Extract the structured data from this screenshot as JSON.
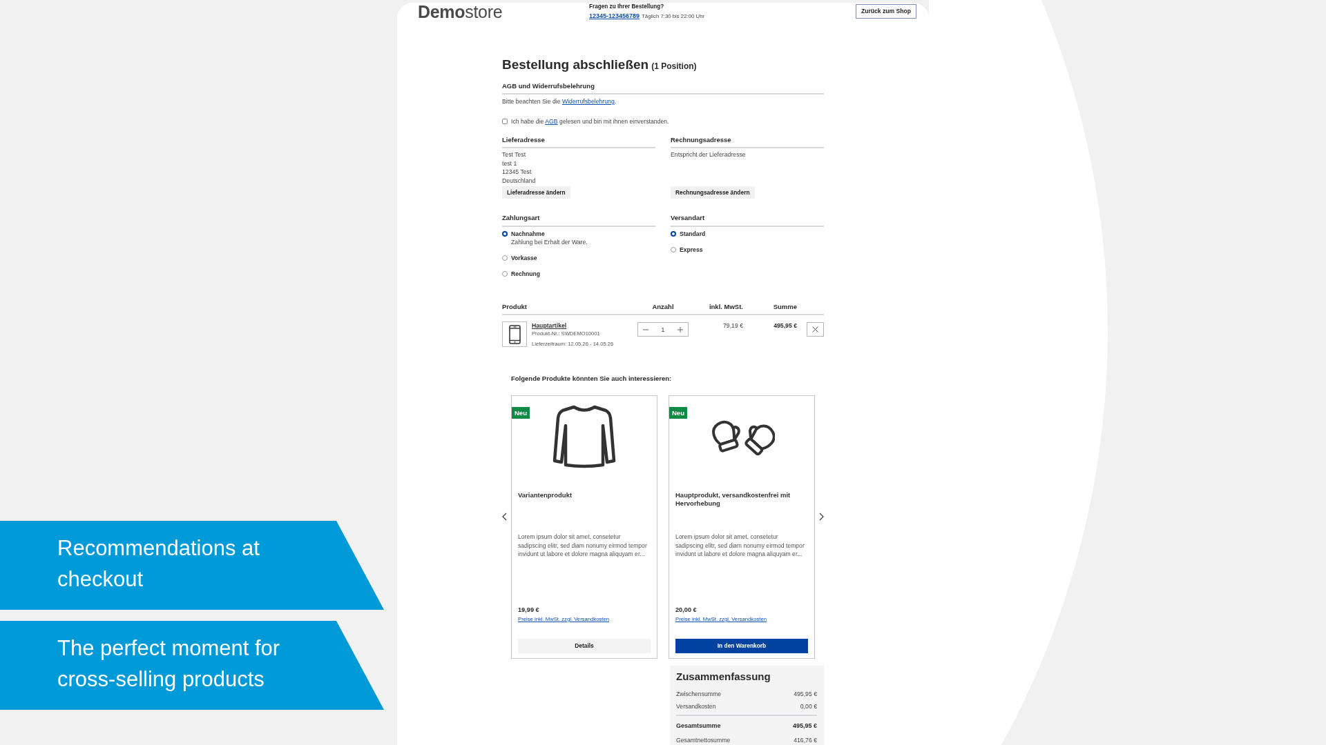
{
  "callouts": [
    "Recommendations at checkout",
    "The perfect moment for cross-selling products"
  ],
  "header": {
    "logo": "**Demo**store",
    "help_title": "Fragen zu Ihrer Bestellung?",
    "phone": "12345-123456789",
    "hours": "Täglich 7:30 bis 22:00 Uhr",
    "back_button": "Zurück zum Shop"
  },
  "title": "Bestellung abschließen",
  "title_count": "(1 Position)",
  "terms": {
    "heading": "AGB und Widerrufsbelehrung",
    "notice": {
      "before": "Bitte beachten Sie die ",
      "link": "Widerrufsbelehrung",
      "after": "."
    },
    "agreement": {
      "checked": false,
      "before": "Ich habe die ",
      "link": "AGB",
      "after": " gelesen und bin mit ihnen einverstanden."
    }
  },
  "addresses": [
    {
      "heading": "Lieferadresse",
      "lines": [
        "Test Test",
        "test 1",
        "12345 Test",
        "Deutschland"
      ],
      "button": "Lieferadresse ändern"
    },
    {
      "heading": "Rechnungsadresse",
      "lines": [
        "Entspricht der Lieferadresse"
      ],
      "button": "Rechnungsadresse ändern"
    }
  ],
  "payment": {
    "heading": "Zahlungsart",
    "options": [
      {
        "label": "Nachnahme",
        "description": "Zahlung bei Erhalt der Ware.",
        "selected": true
      },
      {
        "label": "Vorkasse",
        "selected": false
      },
      {
        "label": "Rechnung",
        "selected": false
      }
    ]
  },
  "shipping": {
    "heading": "Versandart",
    "options": [
      {
        "label": "Standard",
        "selected": true
      },
      {
        "label": "Express",
        "selected": false
      }
    ]
  },
  "cart": {
    "columns": [
      "Produkt",
      "Anzahl",
      "inkl. MwSt.",
      "Summe"
    ],
    "rows": [
      {
        "name": "Hauptartikel",
        "number": "Produkt-Nr.: SWDEMO10001",
        "delivery": "Lieferzeitraum: 12.05.26 - 14.05.26",
        "quantity": "1",
        "unit_price": "79,19 €",
        "total": "495,95 €"
      }
    ]
  },
  "recommendations": {
    "heading": "Folgende Produkte könnten Sie auch interessieren:",
    "products": [
      {
        "badge": "Neu",
        "kind": "shirt",
        "name": "Variantenprodukt",
        "description": "Lorem ipsum dolor sit amet, consetetur sadipscing elitr, sed diam nonumy eirmod tempor invidunt ut labore et dolore magna aliquyam er...",
        "price": "19,99 €",
        "price_note": "Preise inkl. MwSt. zzgl. Versandkosten",
        "button": {
          "label": "Details",
          "primary": false
        }
      },
      {
        "badge": "Neu",
        "kind": "mittens",
        "name": "Hauptprodukt, versandkostenfrei mit Hervorhebung",
        "description": "Lorem ipsum dolor sit amet, consetetur sadipscing elitr, sed diam nonumy eirmod tempor invidunt ut labore et dolore magna aliquyam er...",
        "price": "20,00 €",
        "price_note": "Preise inkl. MwSt. zzgl. Versandkosten",
        "button": {
          "label": "In den Warenkorb",
          "primary": true
        }
      }
    ]
  },
  "summary": {
    "heading": "Zusammenfassung",
    "rows": [
      {
        "kind": "line",
        "label": "Zwischensumme",
        "value": "495,95 €"
      },
      {
        "kind": "line",
        "label": "Versandkosten",
        "value": "0,00 €"
      },
      {
        "kind": "total",
        "label": "Gesamtsumme",
        "value": "495,95 €"
      },
      {
        "kind": "line",
        "label": "Gesamtnettosumme",
        "value": "416,76 €"
      }
    ]
  }
}
